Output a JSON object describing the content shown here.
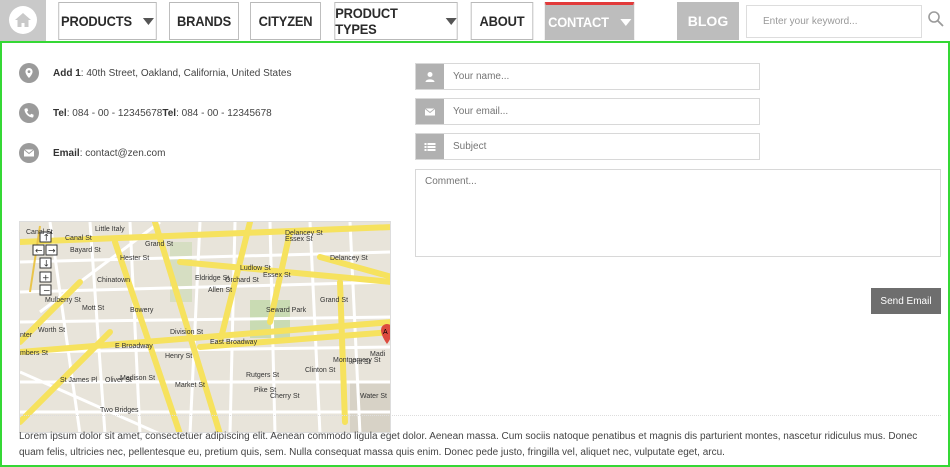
{
  "nav": {
    "items": [
      {
        "label": "PRODUCTS",
        "has_caret": true
      },
      {
        "label": "BRANDS",
        "has_caret": false
      },
      {
        "label": "CITYZEN",
        "has_caret": false
      },
      {
        "label": "PRODUCT TYPES",
        "has_caret": true
      },
      {
        "label": "ABOUT",
        "has_caret": false
      },
      {
        "label": "CONTACT",
        "has_caret": true,
        "active": true
      }
    ],
    "blog_label": "BLOG",
    "search_placeholder": "Enter your keyword..."
  },
  "contact": {
    "address_label": "Add 1",
    "address_value": " : 40th Street, Oakland, California, United States",
    "tel_label": "Tel",
    "tel_value": " : 084 - 00 - 12345678 ",
    "tel_label_2": "Tel",
    "tel_value_2": " : 084 - 00 - 12345678",
    "email_label": "Email",
    "email_value": " : contact@zen.com"
  },
  "map": {
    "streets": [
      "Canal St",
      "Little Italy",
      "Grand St",
      "Delancey St",
      "Essex St",
      "Hester St",
      "Chinatown",
      "Canal St",
      "Bayard St",
      "Mulberry St",
      "Mott St",
      "Bowery",
      "Allen St",
      "Eldridge St",
      "Orchard St",
      "Ludlow St",
      "Essex St",
      "Seward Park",
      "Grand St",
      "Delancey St",
      "Division St",
      "E Broadway",
      "East Broadway",
      "Henry St",
      "Worth St",
      "St James Pl",
      "Oliver St",
      "Madison St",
      "Market St",
      "Rutgers St",
      "Pike St",
      "Clinton St",
      "Montgomery St",
      "Pitt St",
      "Water St",
      "Cherry St",
      "Two Bridges",
      "nter",
      "mbers St",
      "Madi"
    ]
  },
  "form": {
    "name_placeholder": "Your name...",
    "email_placeholder": "Your email...",
    "subject_placeholder": "Subject",
    "comment_placeholder": "Comment...",
    "send_label": "Send Email"
  },
  "lorem": "Lorem ipsum dolor sit amet, consectetuer adipiscing elit. Aenean commodo ligula eget dolor. Aenean massa. Cum sociis natoque penatibus et magnis dis parturient montes, nascetur ridiculus mus. Donec quam felis, ultricies nec, pellentesque eu, pretium quis, sem. Nulla consequat massa quis enim. Donec pede justo, fringilla vel, aliquet nec, vulputate eget, arcu.",
  "colors": {
    "accent_green": "#35d835",
    "active_top": "#e23a3a",
    "nav_gray": "#bdbdbd"
  }
}
